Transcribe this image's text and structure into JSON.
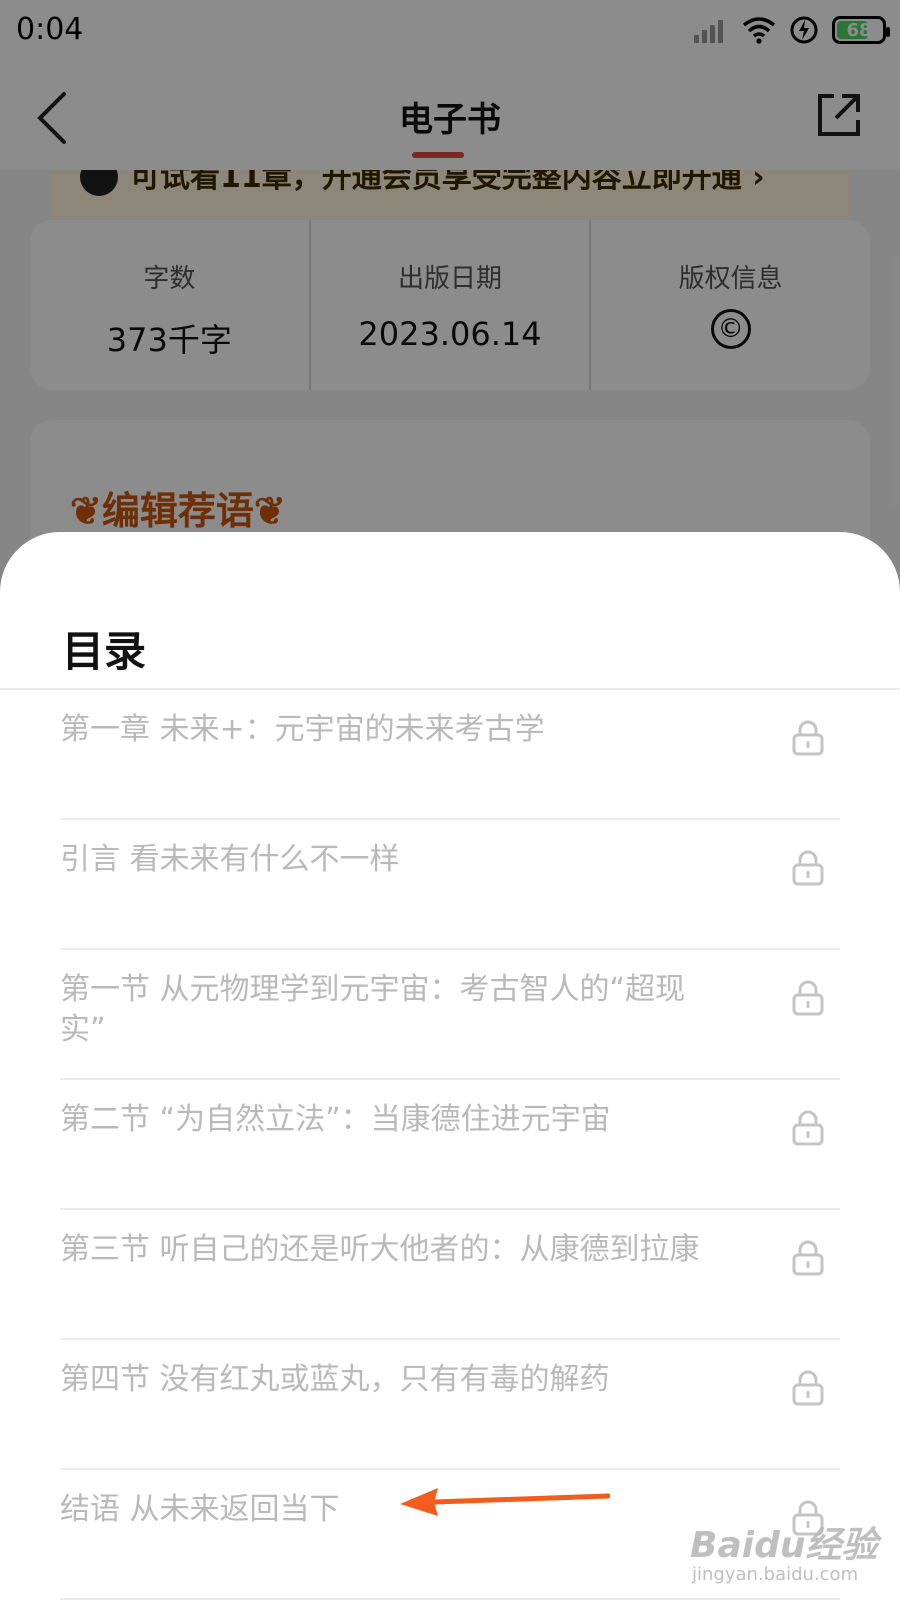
{
  "status_bar": {
    "time": "0:04",
    "battery": "68"
  },
  "nav": {
    "title": "电子书"
  },
  "trial_banner": {
    "text": "可试看11章，开通会员享受完整内容立即开通 ›"
  },
  "info": [
    {
      "label": "字数",
      "value": "373千字"
    },
    {
      "label": "出版日期",
      "value": "2023.06.14"
    },
    {
      "label": "版权信息",
      "value": "©"
    }
  ],
  "recommend": {
    "title": "编辑荐语"
  },
  "toc": {
    "title": "目录",
    "items": [
      {
        "label": "第一章 未来+：元宇宙的未来考古学",
        "locked": true
      },
      {
        "label": "引言 看未来有什么不一样",
        "locked": true
      },
      {
        "label": "第一节 从元物理学到元宇宙：考古智人的“超现实”",
        "locked": true
      },
      {
        "label": "第二节 “为自然立法”：当康德住进元宇宙",
        "locked": true
      },
      {
        "label": "第三节 听自己的还是听大他者的：从康德到拉康",
        "locked": true
      },
      {
        "label": "第四节 没有红丸或蓝丸，只有有毒的解药",
        "locked": true
      },
      {
        "label": "结语 从未来返回当下",
        "locked": true
      }
    ]
  },
  "annotation": {
    "color": "#f25c1c"
  },
  "watermark": {
    "brand": "Baidu经验",
    "url": "jingyan.baidu.com"
  }
}
